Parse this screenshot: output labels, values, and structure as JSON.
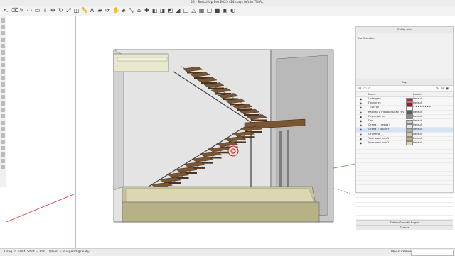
{
  "window": {
    "title": "56 - SketchUp Pro 2023 (24 days left in TRIAL)",
    "traffic_lights": [
      "#ff5f57",
      "#febc2e",
      "#28c840"
    ]
  },
  "toolbar": {
    "icons": [
      "select-icon",
      "eraser-icon",
      "pencil-icon",
      "arc-icon",
      "rectangle-icon",
      "push-pull-icon",
      "move-icon",
      "rotate-icon",
      "scale-icon",
      "offset-icon",
      "tape-measure-icon",
      "text-icon",
      "paint-bucket-icon",
      "orbit-icon",
      "pan-icon",
      "zoom-icon",
      "zoom-extents-icon",
      "warehouse-icon",
      "extension-icon",
      "iso-view-icon",
      "top-view-icon",
      "front-view-icon",
      "right-view-icon",
      "back-view-icon",
      "left-view-icon",
      "xray-icon",
      "wireframe-icon",
      "shaded-icon",
      "textured-icon",
      "monochrome-icon"
    ]
  },
  "entity_info": {
    "panel_title": "Entity Info",
    "selection_text": "No Selection"
  },
  "tags": {
    "panel_title": "Tags",
    "col_name": "Name",
    "col_dashes": "Dashes",
    "rows": [
      {
        "name": "Untagged",
        "color": "#c0282c",
        "dashes": "Default",
        "selected": false
      },
      {
        "name": "Геология",
        "color": "#9a1c1c",
        "dashes": "Default",
        "selected": false
      },
      {
        "name": "_Пустое",
        "color": "#ffffff",
        "dashes": "• • • • • • • •",
        "selected": false
      },
      {
        "name": "Каркас 1 (профильная труба 100х...",
        "color": "#5c5c5c",
        "dashes": "Default",
        "selected": false
      },
      {
        "name": "Перекрытие",
        "color": "#8f8f8f",
        "dashes": "Default",
        "selected": false
      },
      {
        "name": "Пол",
        "color": "#cfcfcf",
        "dashes": "Default",
        "selected": false
      },
      {
        "name": "Стена 1 (левая)",
        "color": "#e6e6e6",
        "dashes": "Default",
        "selected": false
      },
      {
        "name": "Стена 2 (фронт)",
        "color": "#ababab",
        "dashes": "Default",
        "selected": true
      },
      {
        "name": "Ступени",
        "color": "#d7c79a",
        "dashes": "Default",
        "selected": false
      },
      {
        "name": "Чистовой пол 1",
        "color": "#c7b07a",
        "dashes": "Default",
        "selected": false
      },
      {
        "name": "Чистовой пол 2",
        "color": "#e3d4b1",
        "dashes": "Default",
        "selected": false
      }
    ],
    "empty_rows": 17
  },
  "trays": {
    "soften_title": "Soften/Smooth Edges",
    "scenes_title": "Scenes"
  },
  "status": {
    "hint": "Drag to orbit. Shift = Pan, Option = suspend gravity.",
    "measurements_label": "Measurements",
    "measurements_value": ""
  },
  "colors": {
    "step": "#7a5632",
    "step_side": "#4a3320",
    "wall": "#dcdcdc",
    "floor": "#c8c39a",
    "axis_red": "#d83030",
    "axis_green": "#2fa02f",
    "axis_blue": "#3d4fd8"
  }
}
